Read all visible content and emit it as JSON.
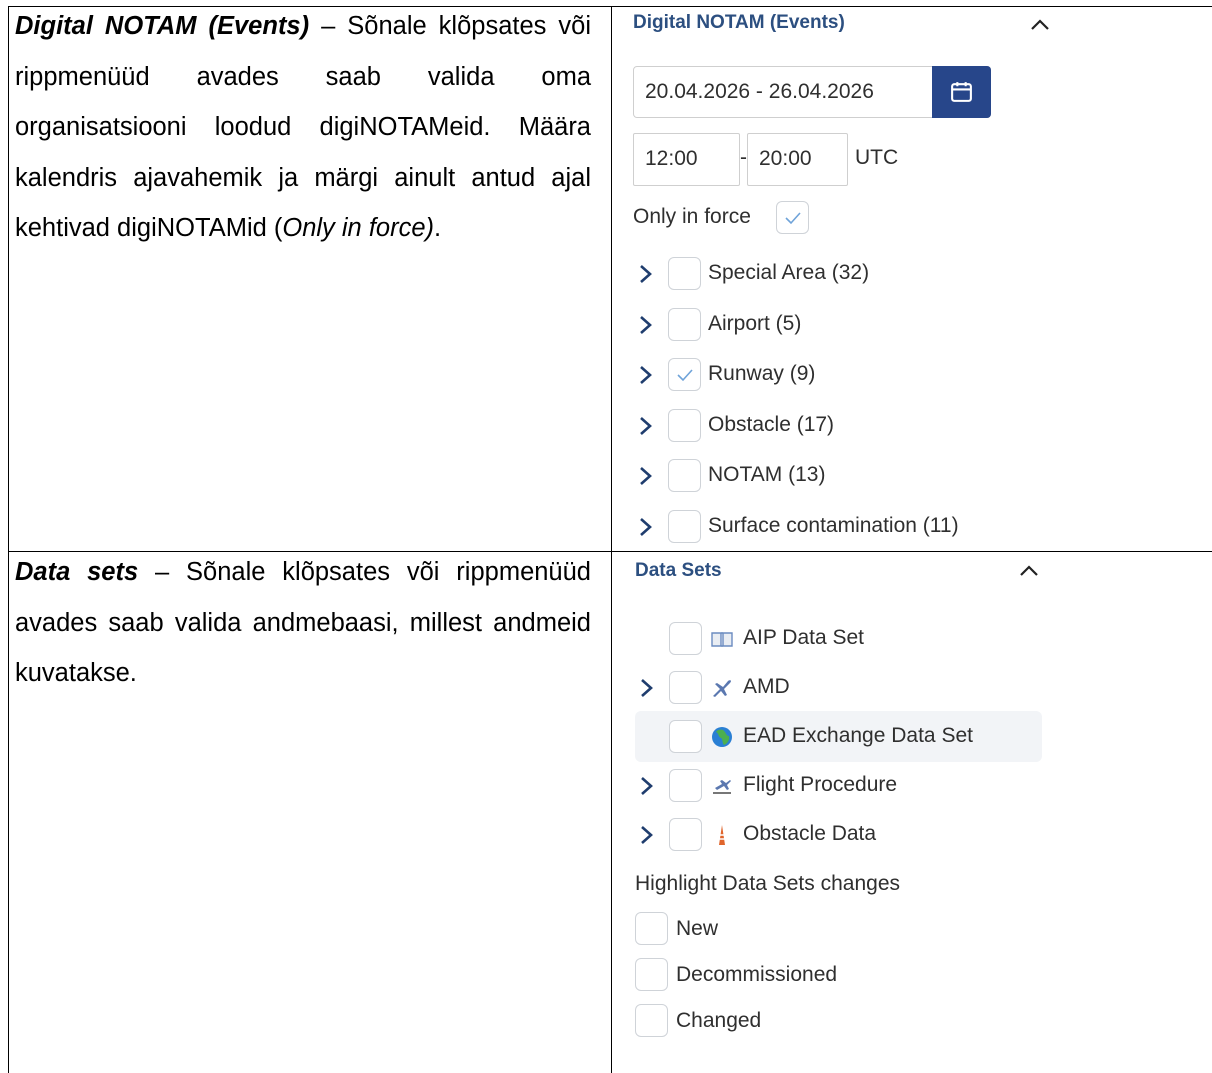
{
  "doc": {
    "row1": {
      "title": "Digital NOTAM (Events)",
      "lines": [
        {
          "parts": [
            {
              "t": "",
              "s": "b"
            }
          ]
        }
      ],
      "text_after_title": " – Sõnale klõpsates või rippmenüüd avades saab valida oma organisatsiooni loodud digiNOTAMeid. Määra kalendris ajavahemik ja märgi ainult antud ajal kehtivad digiNOTAMid (",
      "italic": "Only in force)",
      "end": "."
    },
    "row2": {
      "title": "Data sets",
      "text_after_title": " – Sõnale klõpsates või rippmenüüd avades saab valida andmebaasi, millest andmeid kuvatakse."
    }
  },
  "notam_panel": {
    "title": "Digital NOTAM (Events)",
    "date_range": "20.04.2026 - 26.04.2026",
    "time_from": "12:00",
    "time_sep": "-",
    "time_to": "20:00",
    "tz": "UTC",
    "only_in_force_label": "Only in force",
    "only_in_force_checked": true,
    "items": [
      {
        "label": "Special Area (32)",
        "checked": false
      },
      {
        "label": "Airport (5)",
        "checked": false
      },
      {
        "label": "Runway (9)",
        "checked": true
      },
      {
        "label": "Obstacle (17)",
        "checked": false
      },
      {
        "label": "NOTAM (13)",
        "checked": false
      },
      {
        "label": "Surface contamination (11)",
        "checked": false
      }
    ]
  },
  "datasets_panel": {
    "title": "Data Sets",
    "items": [
      {
        "label": "AIP Data Set",
        "icon": "book-icon",
        "expandable": false
      },
      {
        "label": "AMD",
        "icon": "airplane-icon",
        "expandable": true
      },
      {
        "label": "EAD Exchange Data Set",
        "icon": "globe-icon",
        "expandable": false,
        "highlighted": true
      },
      {
        "label": "Flight Procedure",
        "icon": "procedure-icon",
        "expandable": true
      },
      {
        "label": "Obstacle Data",
        "icon": "tower-icon",
        "expandable": true
      }
    ],
    "highlight_title": "Highlight Data Sets changes",
    "highlight_options": [
      {
        "label": "New"
      },
      {
        "label": "Decommissioned"
      },
      {
        "label": "Changed"
      }
    ]
  },
  "colors": {
    "accent": "#27468a",
    "title": "#2c4f80",
    "check": "#6fa3d9"
  }
}
